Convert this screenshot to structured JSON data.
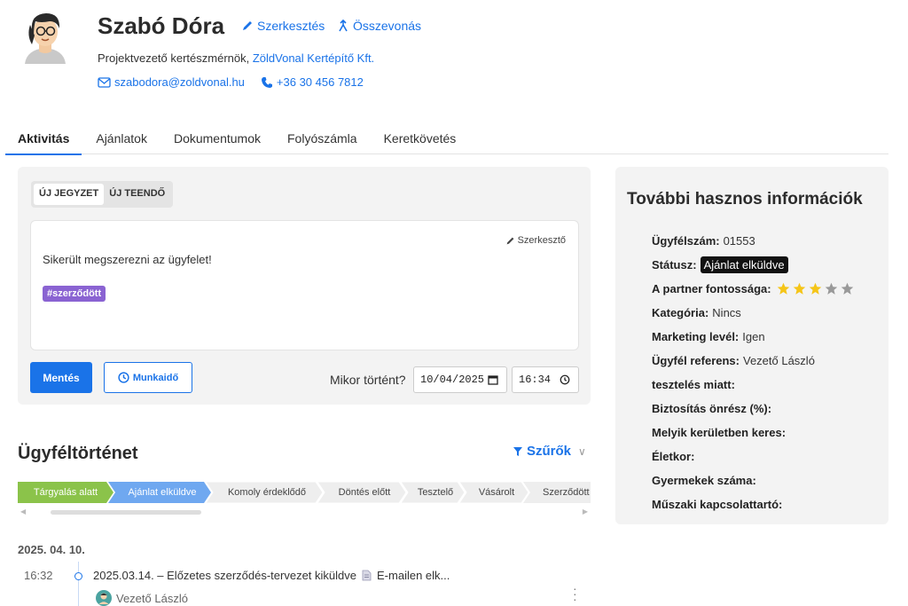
{
  "profile": {
    "name": "Szabó Dóra",
    "edit_label": "Szerkesztés",
    "merge_label": "Összevonás",
    "role": "Projektvezető kertészmérnök,",
    "company": "ZöldVonal Kertépítő Kft.",
    "email": "szabodora@zoldvonal.hu",
    "phone": "+36 30 456 7812"
  },
  "tabs": [
    "Aktivitás",
    "Ajánlatok",
    "Dokumentumok",
    "Folyószámla",
    "Keretkövetés"
  ],
  "note": {
    "tab_note": "ÚJ JEGYZET",
    "tab_todo": "ÚJ TEENDŐ",
    "editor_label": "Szerkesztő",
    "text": "Sikerült megszerezni az ügyfelet!",
    "tag": "#szerződött",
    "save_label": "Mentés",
    "worktime_label": "Munkaidő",
    "when_label": "Mikor történt?",
    "date_value": "10/04/2025",
    "time_value": "16:34"
  },
  "history": {
    "title": "Ügyféltörténet",
    "filters_label": "Szűrők",
    "stages": [
      "Tárgyalás alatt",
      "Ajánlat elküldve",
      "Komoly érdeklődő",
      "Döntés előtt",
      "Tesztelő",
      "Vásárolt",
      "Szerződött"
    ],
    "date_heading": "2025. 04. 10.",
    "entry_time": "16:32",
    "entry_text": "2025.03.14. – Előzetes szerződés-tervezet kiküldve",
    "entry_doc": "E-mailen elk...",
    "entry_user": "Vezető László"
  },
  "info": {
    "title": "További hasznos információk",
    "client_no_label": "Ügyfélszám:",
    "client_no": "01553",
    "status_label": "Státusz:",
    "status": "Ajánlat elküldve",
    "importance_label": "A partner fontossága:",
    "importance_rating": 3,
    "importance_max": 5,
    "category_label": "Kategória:",
    "category": "Nincs",
    "marketing_label": "Marketing levél:",
    "marketing": "Igen",
    "referent_label": "Ügyfél referens:",
    "referent": "Vezető László",
    "testing_label": "tesztelés miatt:",
    "insurance_label": "Biztosítás önrész (%):",
    "district_label": "Melyik kerületben keres:",
    "age_label": "Életkor:",
    "children_label": "Gyermekek száma:",
    "tech_contact_label": "Műszaki kapcsolattartó:"
  },
  "colors": {
    "accent": "#1a73e8",
    "stage_done": "#8bc34a",
    "stage_current": "#6fa8f0",
    "tag": "#8a63d2",
    "star_on": "#f5c518",
    "star_off": "#999999"
  }
}
